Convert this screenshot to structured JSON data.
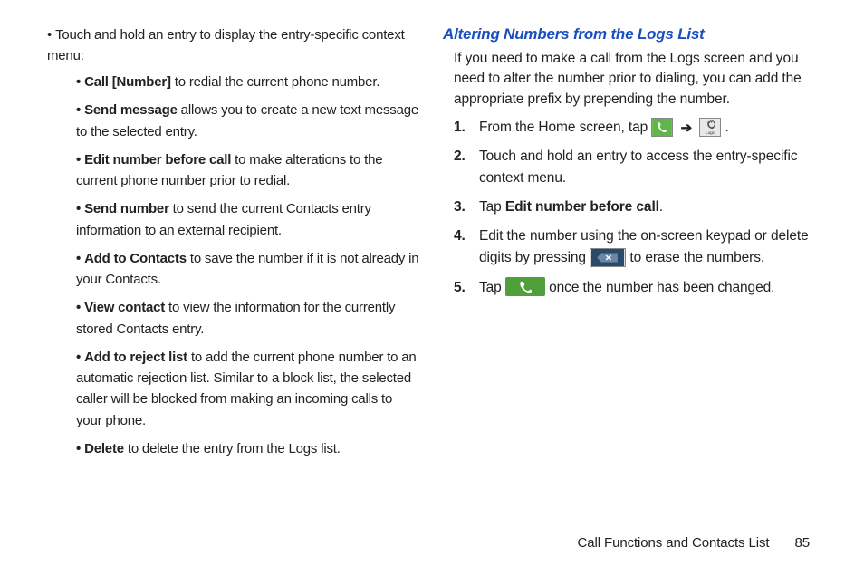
{
  "left": {
    "intro": "Touch and hold an entry to display the entry-specific context menu:",
    "items": [
      {
        "term": "Call [Number]",
        "desc": " to redial the current phone number."
      },
      {
        "term": "Send message",
        "desc": " allows you to create a new text message to the selected entry."
      },
      {
        "term": "Edit number before call",
        "desc": " to make alterations to the current phone number prior to redial."
      },
      {
        "term": "Send number",
        "desc": " to send the current Contacts entry information to an external recipient."
      },
      {
        "term": "Add to Contacts",
        "desc": " to save the number if it is not already in your Contacts."
      },
      {
        "term": "View contact",
        "desc": " to view the information for the currently stored Contacts entry."
      },
      {
        "term": "Add to reject list",
        "desc": " to add the current phone number to an automatic rejection list. Similar to a block list, the selected caller will be blocked from making an incoming calls to your phone."
      },
      {
        "term": "Delete",
        "desc": " to delete the entry from the Logs list."
      }
    ]
  },
  "right": {
    "title": "Altering Numbers from the Logs List",
    "body": "If you need to make a call from the Logs screen and you need to alter the number prior to dialing, you can add the appropriate prefix by prepending the number.",
    "steps": {
      "s1a": "From the Home screen, tap ",
      "s1b": " .",
      "s2": "Touch and hold an entry to access the entry-specific context menu.",
      "s3a": "Tap ",
      "s3b": "Edit number before call",
      "s3c": ".",
      "s4a": "Edit the number using the on-screen keypad or delete digits by pressing ",
      "s4b": " to erase the numbers.",
      "s5a": "Tap ",
      "s5b": " once the number has been changed."
    }
  },
  "arrow": "➔",
  "footer": {
    "section": "Call Functions and Contacts List",
    "page": "85"
  }
}
